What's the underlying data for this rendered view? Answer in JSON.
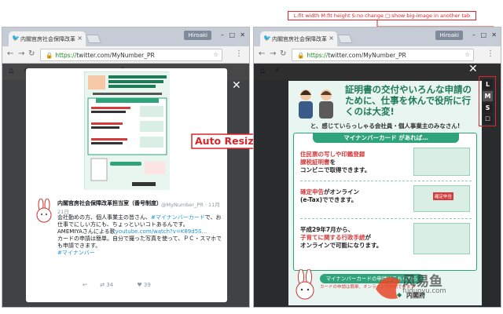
{
  "browser": {
    "tab_title": "内閣官房社会保障改革",
    "profile_name": "Hiroaki",
    "url_scheme": "https://",
    "url_rest": "twitter.com/MyNumber_PR"
  },
  "annotation": {
    "caption": "L:fit width  M:fit height  S:no change  □:show big-image in another tab",
    "arrow_label": "Auto Resize"
  },
  "resize_buttons": {
    "l": "L",
    "m": "M",
    "s": "S",
    "big": "□"
  },
  "tweet": {
    "author": "内閣官房社会保障改革担当室（番号制度）",
    "handle": "@MyNumber_PR · 11月",
    "date": "21日",
    "lines": [
      "会社勤めの方、個人事業主の皆さん、",
      "仕事でにしい方にも、ちょっといいコトあるんです。",
      "AMEMIYAさんによる歌",
      "カードの申請は簡単。自分で撮った写真を使って、ＰＣ・スマホで",
      "も申請できます。"
    ],
    "line1_tag": "#マイナンバーカード",
    "line1_tail": "で、お",
    "line3_link": "youtube.com/watch?v=K89d5S...",
    "hashtag": "#マイナンバー",
    "retweets": "34",
    "likes": "39"
  },
  "flyer": {
    "headline": "証明書の交付やいろんな申請のために、仕事を休んで役所に行くのは大変!",
    "subline": "と、感じていらっしゃる会社員・個人事業主のみなさん!",
    "card_title": "マイナンバーカード があれば…",
    "item1_a": "住民票の写しや印鑑登録",
    "item1_b": "課税証明書",
    "item1_c": "を",
    "item1_d": "コンビニで取得できます。",
    "item2_a": "確定申告",
    "item2_b": "がオンライン",
    "item2_c": "(e-Tax)でできます。",
    "item2_badge": "確定申告",
    "item3_a": "平成29年7月から、",
    "item3_b": "子育てに関する行政手続",
    "item3_c": "が",
    "item3_d": "オンラインで可能になります。",
    "pill": "マイナンバーカードの申請はこちらから",
    "note": "カードの申請は簡単、オンラインで申請できます",
    "org": "内閣府",
    "mascot_tag": "マイナちゃん"
  },
  "watermark": {
    "text": "风易鱼",
    "url": "fuduoyu.com"
  },
  "colors": {
    "accent_red": "#d9262b",
    "flyer_green": "#2fa37c",
    "twitter_blue": "#1da1f2"
  }
}
